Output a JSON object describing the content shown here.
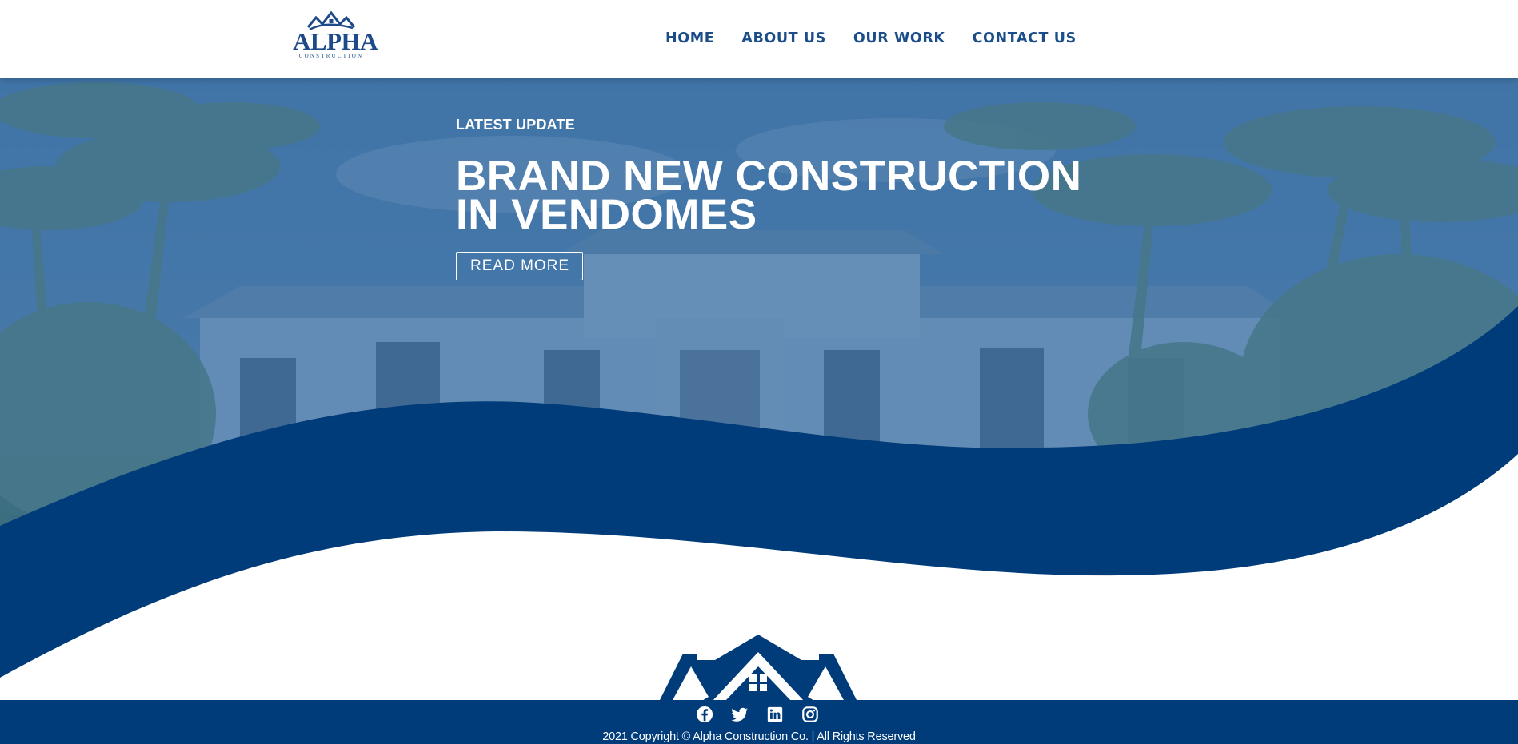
{
  "brand": {
    "name": "ALPHA",
    "tagline": "CONSTRUCTION"
  },
  "nav": {
    "items": [
      {
        "label": "HOME"
      },
      {
        "label": "ABOUT US"
      },
      {
        "label": "OUR WORK"
      },
      {
        "label": "CONTACT US"
      }
    ]
  },
  "hero": {
    "eyebrow": "LATEST UPDATE",
    "title_line1": "BRAND NEW CONSTRUCTION",
    "title_line2": "IN VENDOMES",
    "button_label": "READ MORE"
  },
  "footer": {
    "socials": [
      "facebook-icon",
      "twitter-icon",
      "linkedin-icon",
      "instagram-icon"
    ],
    "copyright": "2021 Copyright © Alpha Construction Co. | All Rights Reserved"
  },
  "colors": {
    "brand_blue": "#003b7a",
    "nav_text": "#1b4d89",
    "hero_overlay": "#4275a8",
    "white": "#ffffff"
  }
}
